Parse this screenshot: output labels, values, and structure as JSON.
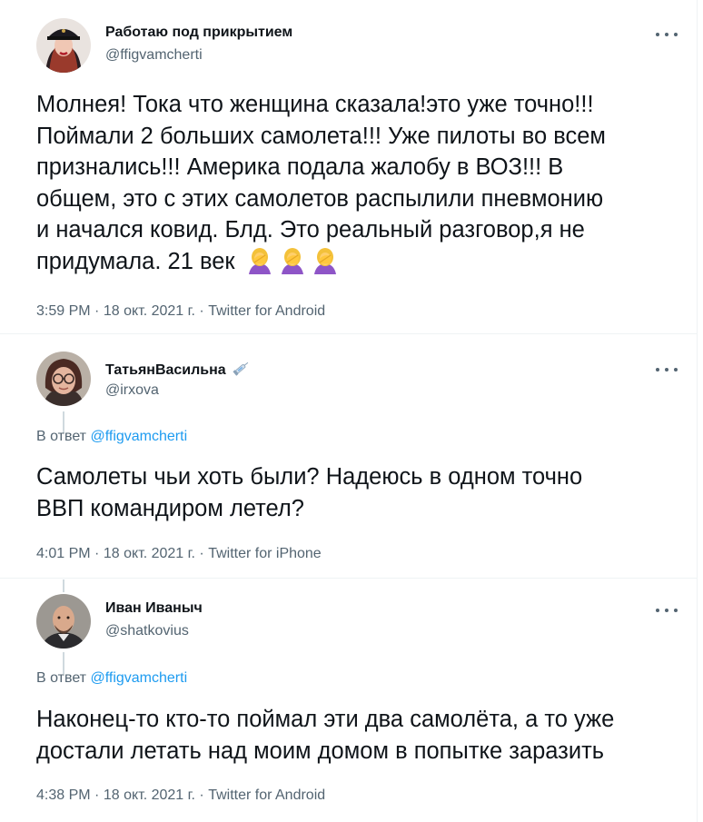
{
  "tweets": [
    {
      "name": "Работаю под прикрытием",
      "handle": "@ffigvamcherti",
      "avatar": "avatar-woman-in-cap",
      "text_line1": "Молнея! Тока что женщина сказала!это уже точно!!!",
      "text_line2": "Поймали 2 больших самолета!!! Уже  пилоты во всем",
      "text_line3": "признались!!! Америка подала жалобу в ВОЗ!!! В",
      "text_line4": "общем, это с этих самолетов распылили пневмонию",
      "text_line5": "и начался ковид. Блд. Это реальный разговор,я не",
      "text_line6": "придумала. 21 век",
      "emoji": "woman-facepalming x3",
      "time": "3:59 PM",
      "date": "18 окт. 2021 г.",
      "source": "Twitter for Android",
      "dot": "·"
    },
    {
      "name": "ТатьянВасильна",
      "name_badge": "syringe-icon",
      "handle": "@irxova",
      "reply_prefix": "В ответ",
      "reply_to": "@ffigvamcherti",
      "text_line1": "Самолеты чьи хоть были? Надеюсь в одном точно",
      "text_line2": "ВВП командиром летел?",
      "time": "4:01 PM",
      "date": "18 окт. 2021 г.",
      "source": "Twitter for iPhone",
      "dot": "·"
    },
    {
      "name": "Иван Иваныч",
      "handle": "@shatkovius",
      "reply_prefix": "В ответ",
      "reply_to": "@ffigvamcherti",
      "text_line1": "Наконец-то кто-то поймал эти два самолёта, а то уже",
      "text_line2": "достали летать над моим домом в попытке заразить",
      "time": "4:38 PM",
      "date": "18 окт. 2021 г.",
      "source": "Twitter for Android",
      "dot": "·"
    }
  ],
  "colors": {
    "text": "#0f1419",
    "secondary": "#536471",
    "link": "#1d9bf0",
    "border": "#eff3f4",
    "thread_line": "#cfd9de"
  }
}
